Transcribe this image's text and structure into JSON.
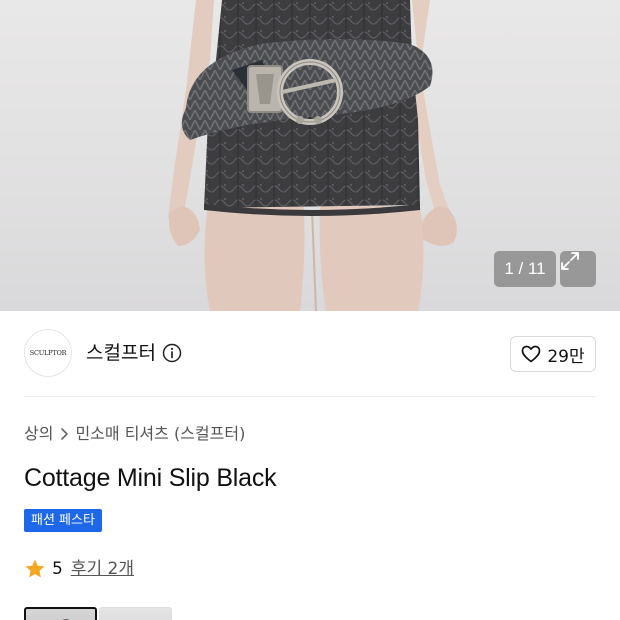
{
  "gallery": {
    "counter": "1 / 11",
    "expand_icon": "expand-icon"
  },
  "brand": {
    "logo_text": "SCULPTOR",
    "name": "스컬프터",
    "info_icon": "info-icon",
    "likes": "29만",
    "like_icon": "heart-outline-icon"
  },
  "breadcrumb": {
    "category": "상의",
    "separator_icon": "chevron-right-icon",
    "subcategory": "민소매 티셔츠 (스컬프터)"
  },
  "product": {
    "title": "Cottage Mini Slip Black",
    "badge": "패션 페스타"
  },
  "rating": {
    "star_icon": "star-icon",
    "star_color": "#f5a623",
    "score": "5",
    "reviews": "후기 2개"
  },
  "colors": {
    "badge_bg": "#1e67e8"
  }
}
